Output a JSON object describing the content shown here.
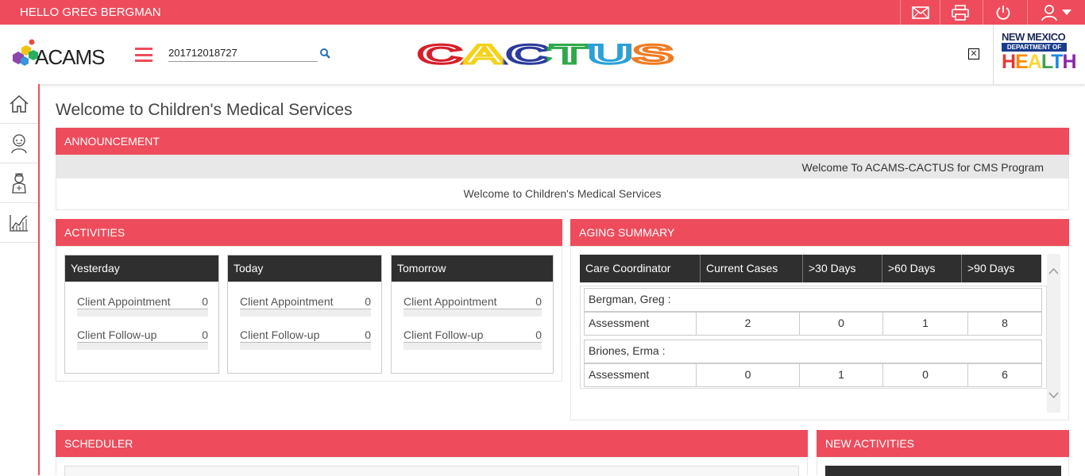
{
  "topbar": {
    "greeting": "HELLO GREG BERGMAN",
    "icons": [
      "mail-icon",
      "printer-icon",
      "power-icon",
      "user-icon"
    ],
    "accent_color": "#ee4c5c"
  },
  "header": {
    "logo_text": "ACAMS",
    "search_value": "201712018727",
    "center_logo": "CACTUS",
    "nm_logo": {
      "line1": "NEW MEXICO",
      "line2": "DEPARTMENT OF",
      "line3": "HEALTH"
    }
  },
  "sidebar": {
    "items": [
      "home-icon",
      "client-icon",
      "provider-icon",
      "reports-chart-icon"
    ]
  },
  "page": {
    "title": "Welcome to Children's Medical Services"
  },
  "announcement": {
    "heading": "ANNOUNCEMENT",
    "ticker": "Welcome To ACAMS-CACTUS for CMS Program",
    "message": "Welcome to Children's Medical Services"
  },
  "activities": {
    "heading": "ACTIVITIES",
    "cards": [
      {
        "title": "Yesterday",
        "rows": [
          {
            "label": "Client Appointment",
            "count": "0"
          },
          {
            "label": "Client Follow-up",
            "count": "0"
          }
        ]
      },
      {
        "title": "Today",
        "rows": [
          {
            "label": "Client Appointment",
            "count": "0"
          },
          {
            "label": "Client Follow-up",
            "count": "0"
          }
        ]
      },
      {
        "title": "Tomorrow",
        "rows": [
          {
            "label": "Client Appointment",
            "count": "0"
          },
          {
            "label": "Client Follow-up",
            "count": "0"
          }
        ]
      }
    ]
  },
  "aging": {
    "heading": "AGING SUMMARY",
    "columns": [
      "Care Coordinator",
      "Current Cases",
      ">30 Days",
      ">60 Days",
      ">90 Days"
    ],
    "groups": [
      {
        "coordinator": "Bergman, Greg :",
        "rows": [
          {
            "type": "Assessment",
            "current": "2",
            "d30": "0",
            "d60": "1",
            "d90": "8"
          }
        ]
      },
      {
        "coordinator": "Briones, Erma :",
        "rows": [
          {
            "type": "Assessment",
            "current": "0",
            "d30": "1",
            "d60": "0",
            "d90": "6"
          }
        ]
      }
    ]
  },
  "scheduler": {
    "heading": "SCHEDULER"
  },
  "new_activities": {
    "heading": "NEW ACTIVITIES"
  }
}
